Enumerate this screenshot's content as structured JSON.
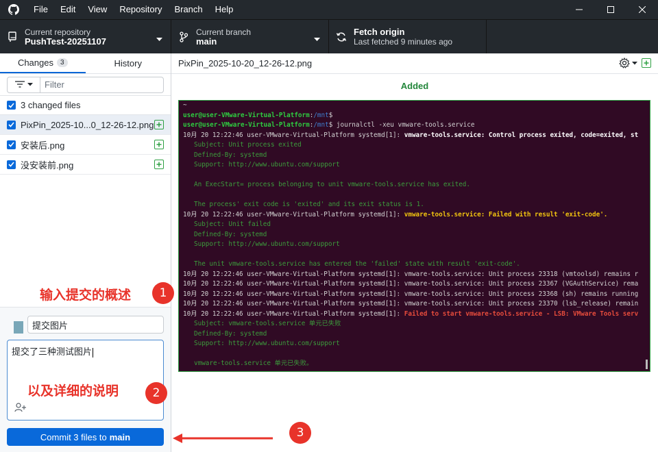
{
  "menu": [
    "File",
    "Edit",
    "View",
    "Repository",
    "Branch",
    "Help"
  ],
  "toolbar": {
    "repo_label": "Current repository",
    "repo_name": "PushTest-20251107",
    "branch_label": "Current branch",
    "branch_name": "main",
    "fetch_title": "Fetch origin",
    "fetch_sub": "Last fetched 9 minutes ago"
  },
  "tabs": {
    "changes": "Changes",
    "changes_count": "3",
    "history": "History"
  },
  "filter": {
    "placeholder": "Filter"
  },
  "changed_files_label": "3 changed files",
  "files": [
    {
      "name": "PixPin_2025-10...0_12-26-12.png"
    },
    {
      "name": "安装后.png"
    },
    {
      "name": "没安装前.png"
    }
  ],
  "commit": {
    "summary": "提交图片",
    "description": "提交了三种测试图片",
    "button_prefix": "Commit 3 files to",
    "button_branch": "main"
  },
  "diff": {
    "filename": "PixPin_2025-10-20_12-26-12.png",
    "status": "Added"
  },
  "terminal": {
    "lines": [
      {
        "type": "plain",
        "text": "~"
      },
      {
        "type": "prompt",
        "user": "user@user-VMware-Virtual-Platform",
        "path": "/mnt",
        "cmd": "$"
      },
      {
        "type": "prompt",
        "user": "user@user-VMware-Virtual-Platform",
        "path": "/mnt",
        "cmd": "$ journalctl -xeu vmware-tools.service"
      },
      {
        "type": "log",
        "prefix": "10月 20 12:22:46 user-VMware-Virtual-Platform systemd[1]: ",
        "msg": "vmware-tools.service: Control process exited, code=exited, st",
        "style": "w"
      },
      {
        "type": "detail",
        "text": "Subject: Unit process exited"
      },
      {
        "type": "detail",
        "text": "Defined-By: systemd"
      },
      {
        "type": "detail",
        "text": "Support: http://www.ubuntu.com/support"
      },
      {
        "type": "detail",
        "text": ""
      },
      {
        "type": "detail",
        "text": "An ExecStart= process belonging to unit vmware-tools.service has exited."
      },
      {
        "type": "detail",
        "text": ""
      },
      {
        "type": "detail",
        "text": "The process' exit code is 'exited' and its exit status is 1."
      },
      {
        "type": "log",
        "prefix": "10月 20 12:22:46 user-VMware-Virtual-Platform systemd[1]: ",
        "msg": "vmware-tools.service: Failed with result 'exit-code'.",
        "style": "y"
      },
      {
        "type": "detail",
        "text": "Subject: Unit failed"
      },
      {
        "type": "detail",
        "text": "Defined-By: systemd"
      },
      {
        "type": "detail",
        "text": "Support: http://www.ubuntu.com/support"
      },
      {
        "type": "detail",
        "text": ""
      },
      {
        "type": "detail",
        "text": "The unit vmware-tools.service has entered the 'failed' state with result 'exit-code'."
      },
      {
        "type": "log",
        "prefix": "10月 20 12:22:46 user-VMware-Virtual-Platform systemd[1]: ",
        "msg": "vmware-tools.service: Unit process 23318 (vmtoolsd) remains r",
        "style": "n"
      },
      {
        "type": "log",
        "prefix": "10月 20 12:22:46 user-VMware-Virtual-Platform systemd[1]: ",
        "msg": "vmware-tools.service: Unit process 23367 (VGAuthService) rema",
        "style": "n"
      },
      {
        "type": "log",
        "prefix": "10月 20 12:22:46 user-VMware-Virtual-Platform systemd[1]: ",
        "msg": "vmware-tools.service: Unit process 23368 (sh) remains running",
        "style": "n"
      },
      {
        "type": "log",
        "prefix": "10月 20 12:22:46 user-VMware-Virtual-Platform systemd[1]: ",
        "msg": "vmware-tools.service: Unit process 23370 (lsb_release) remain",
        "style": "n"
      },
      {
        "type": "log",
        "prefix": "10月 20 12:22:46 user-VMware-Virtual-Platform systemd[1]: ",
        "msg": "Failed to start vmware-tools.service - LSB: VMware Tools serv",
        "style": "r"
      },
      {
        "type": "detail",
        "text": "Subject: vmware-tools.service 单元已失败"
      },
      {
        "type": "detail",
        "text": "Defined-By: systemd"
      },
      {
        "type": "detail",
        "text": "Support: http://www.ubuntu.com/support"
      },
      {
        "type": "detail",
        "text": ""
      },
      {
        "type": "detail",
        "text": "vmware-tools.service 单元已失败。"
      }
    ]
  },
  "annotations": {
    "a1": "输入提交的概述",
    "n1": "1",
    "a2": "以及详细的说明",
    "n2": "2",
    "n3": "3"
  },
  "colors": {
    "accent": "#0969da",
    "added": "#22863a",
    "annotation": "#e8332a"
  }
}
